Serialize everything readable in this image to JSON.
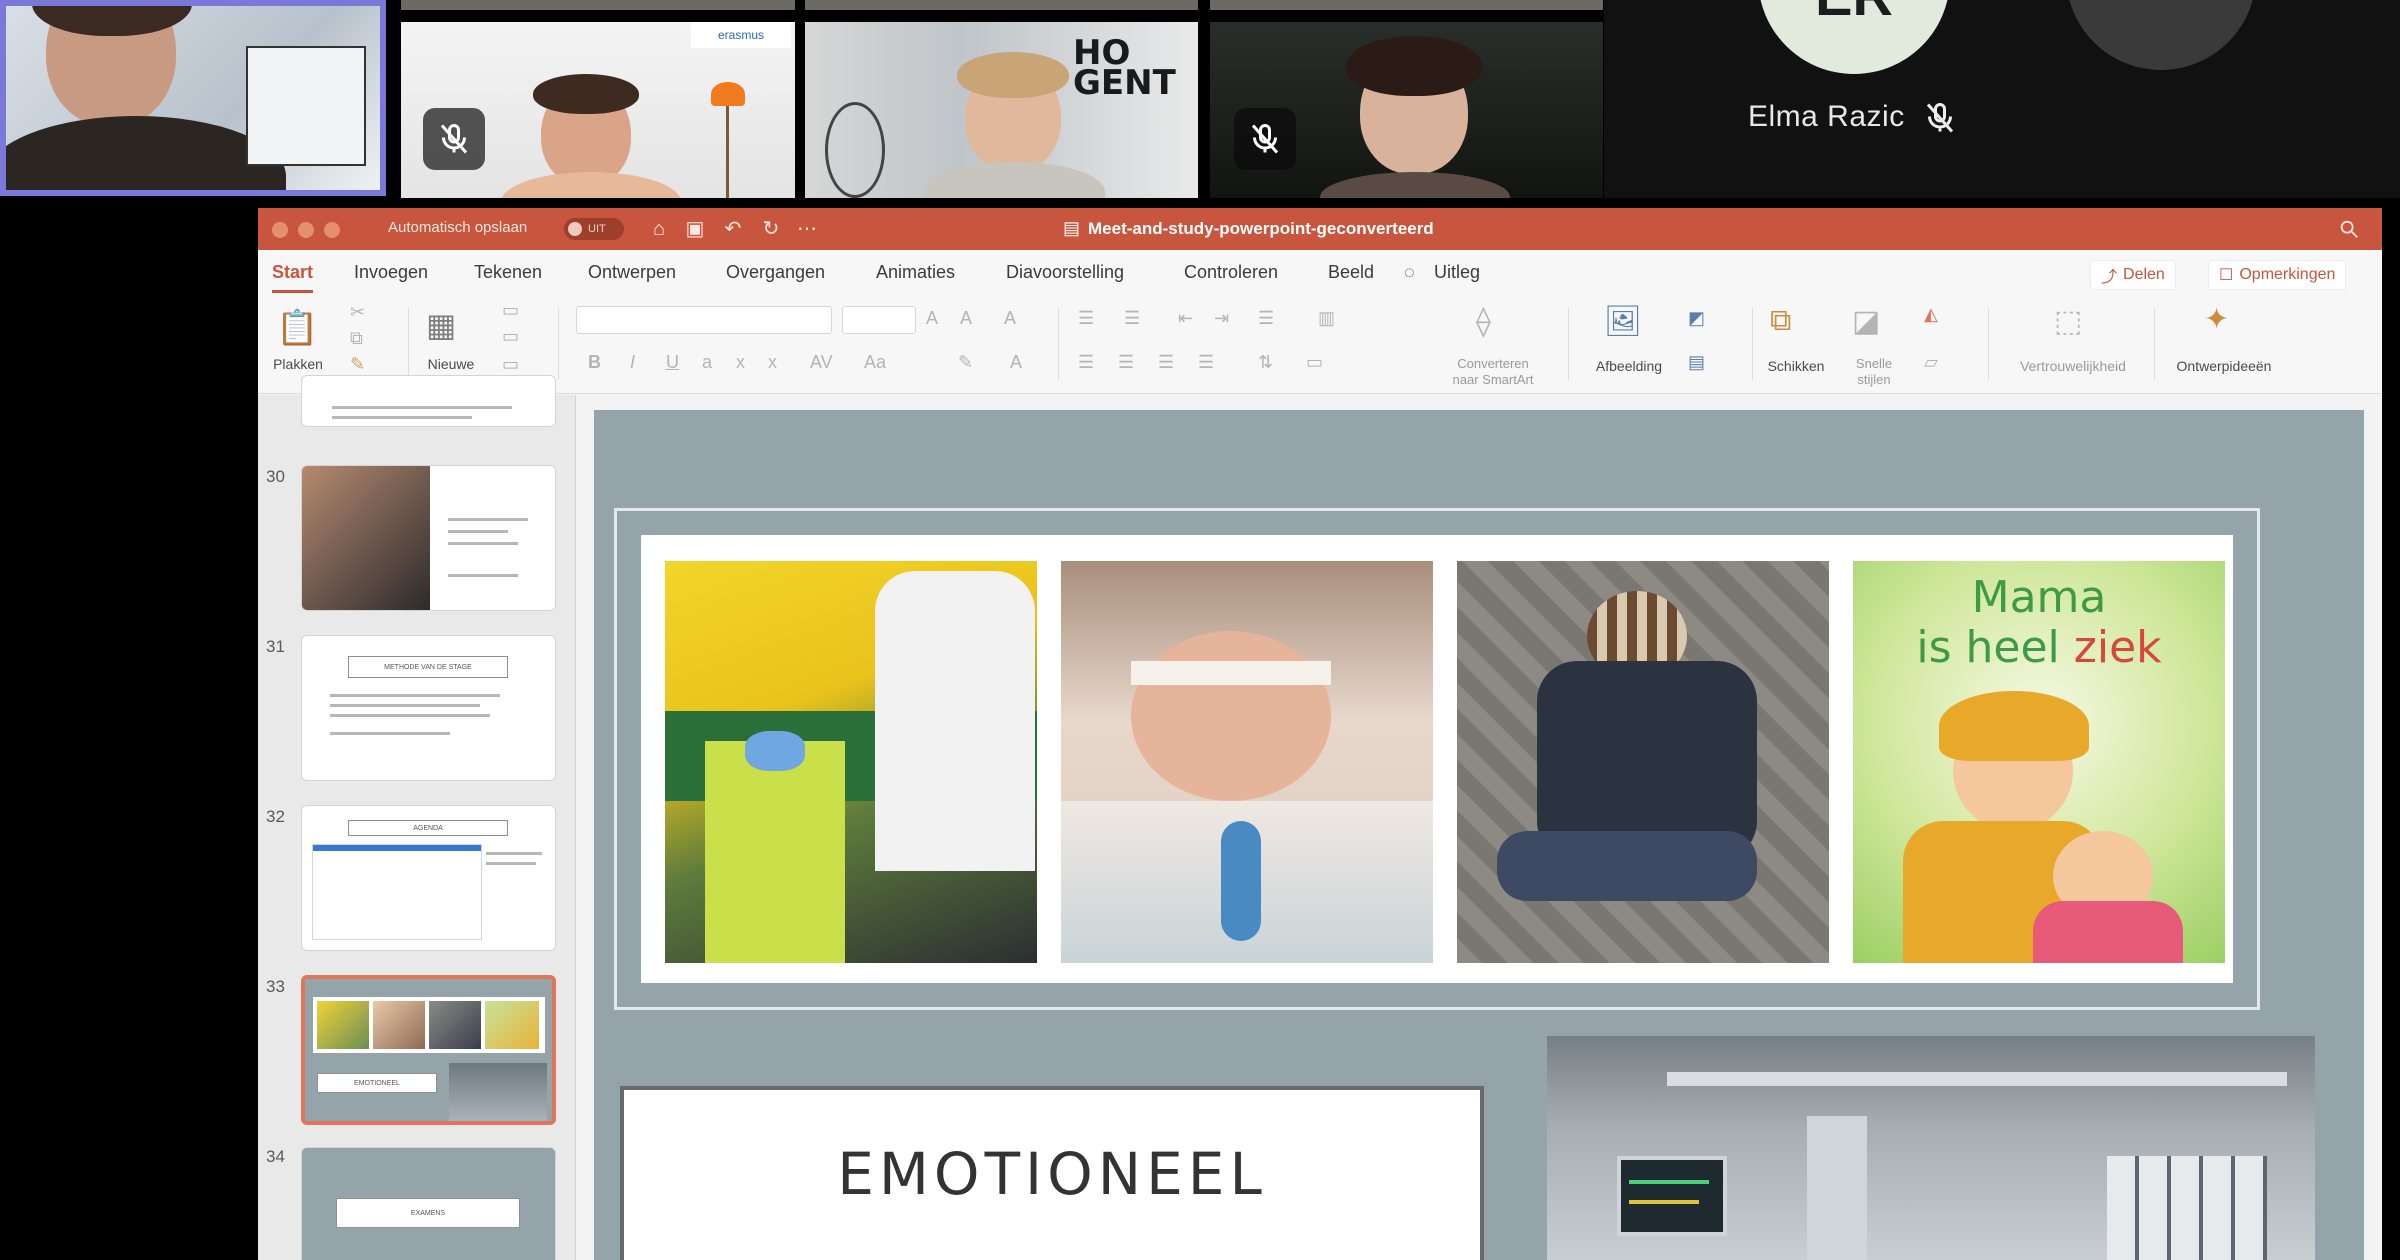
{
  "call": {
    "participant_initials": "ER",
    "participant_name": "Elma Razic",
    "hogent_logo": "HO\nGENT",
    "erasmus_badge": "erasmus"
  },
  "window": {
    "autosave_label": "Automatisch opslaan",
    "autosave_state": "UIT",
    "doc_title": "Meet-and-study-powerpoint-geconverteerd"
  },
  "menu": {
    "items": [
      "Start",
      "Invoegen",
      "Tekenen",
      "Ontwerpen",
      "Overgangen",
      "Animaties",
      "Diavoorstelling",
      "Controleren",
      "Beeld"
    ],
    "tell_me": "Uitleg",
    "share_label": "Delen",
    "comments_label": "Opmerkingen"
  },
  "ribbon": {
    "paste": "Plakken",
    "new_slide": "Nieuwe\ndia",
    "convert_smartart": "Converteren\nnaar SmartArt",
    "picture": "Afbeelding",
    "arrange": "Schikken",
    "quick_styles": "Snelle\nstijlen",
    "sensitivity": "Vertrouwelijkheid",
    "design_ideas": "Ontwerpideeën"
  },
  "thumbnails": [
    {
      "num": "30"
    },
    {
      "num": "31",
      "title": "METHODE VAN DE STAGE"
    },
    {
      "num": "32",
      "title": "AGENDA"
    },
    {
      "num": "33",
      "title": "EMOTIONEEL"
    },
    {
      "num": "34",
      "title": "EXAMENS"
    }
  ],
  "slide": {
    "mama_line1": "Mama",
    "mama_line2": "is heel",
    "mama_line3": "ziek",
    "heading": "EMOTIONEEL"
  },
  "colors": {
    "accent": "#c8553d",
    "slide_bg": "#95a3ab",
    "speaker_border": "#7a78d8"
  }
}
